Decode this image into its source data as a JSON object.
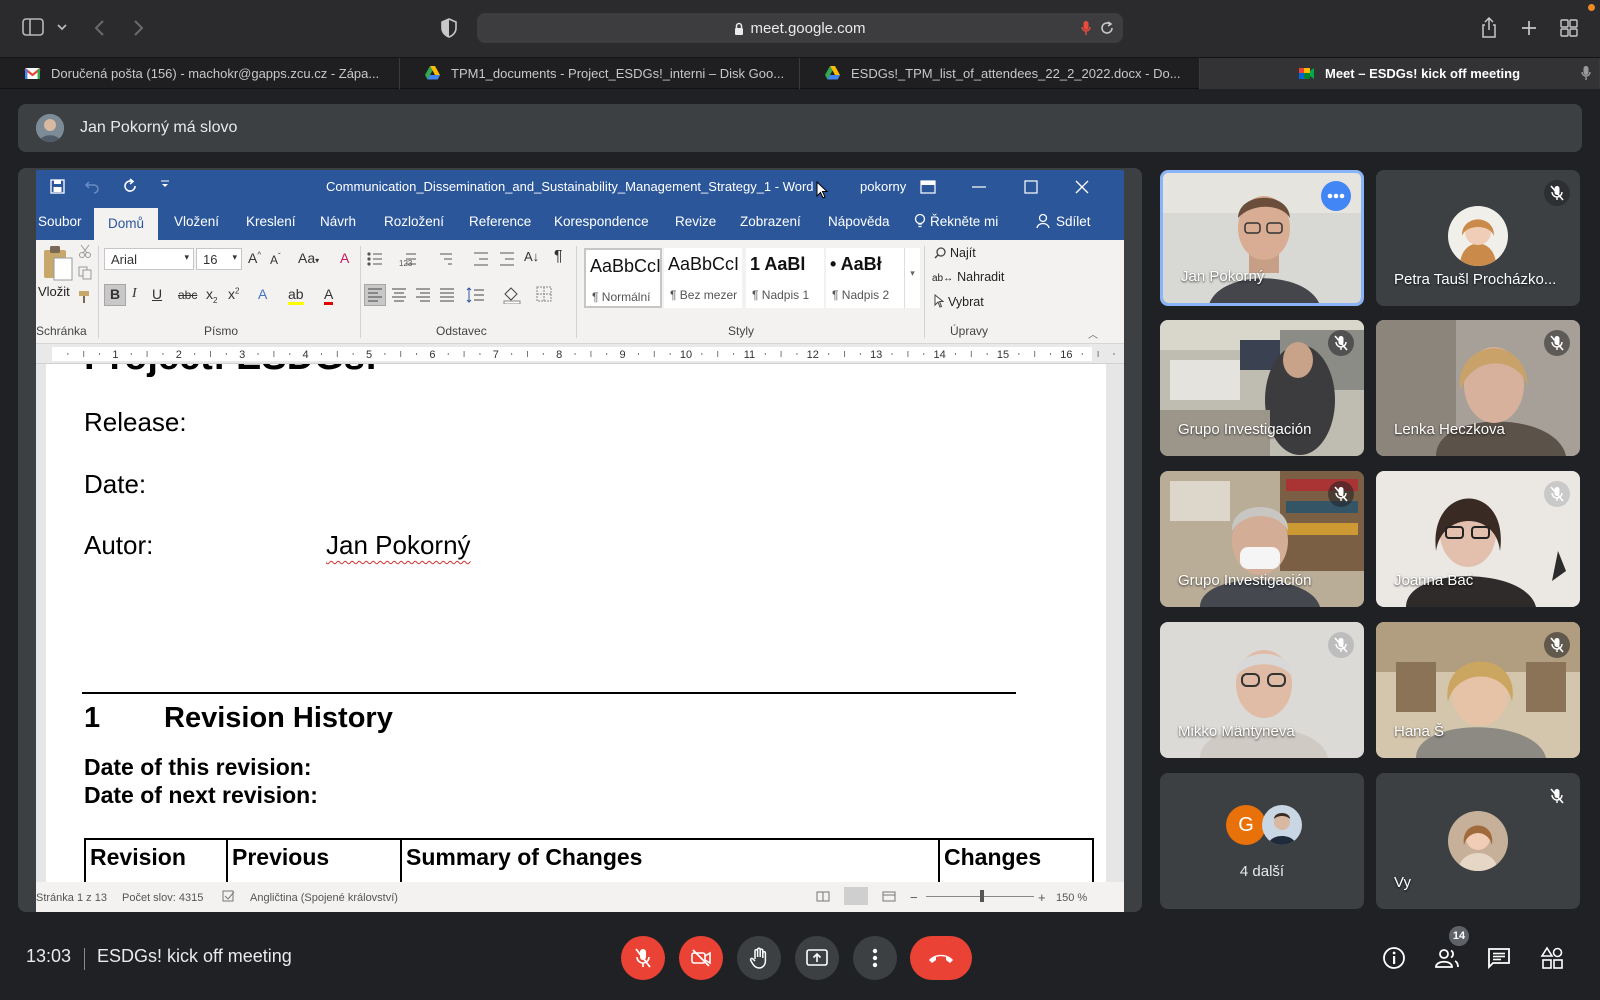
{
  "browser": {
    "url": "meet.google.com",
    "tabs": [
      {
        "label": "Doručená pošta (156) - machokr@gapps.zcu.cz - Zápa...",
        "icon": "gmail-icon"
      },
      {
        "label": "TPM1_documents - Project_ESDGs!_interni – Disk Goo...",
        "icon": "google-drive-icon"
      },
      {
        "label": "ESDGs!_TPM_list_of_attendees_22_2_2022.docx - Do...",
        "icon": "google-drive-icon"
      },
      {
        "label": "Meet – ESDGs! kick off meeting",
        "icon": "google-meet-icon",
        "active": true
      }
    ]
  },
  "meet": {
    "speaker_banner": "Jan Pokorný má slovo",
    "clock": "13:03",
    "meeting_title": "ESDGs! kick off meeting",
    "people_count": "14",
    "participants": [
      {
        "name": "Jan Pokorný",
        "speaking": true,
        "muted": false
      },
      {
        "name": "Petra Taušl Procházko...",
        "muted": true,
        "avatar": true
      },
      {
        "name": "Grupo Investigación",
        "muted": true
      },
      {
        "name": "Lenka Heczkova",
        "muted": true
      },
      {
        "name": "Grupo Investigación",
        "muted": true
      },
      {
        "name": "Joanna Bać",
        "muted": true
      },
      {
        "name": "Mikko Mäntyneva",
        "muted": true
      },
      {
        "name": "Hana Š",
        "muted": true
      },
      {
        "name": "4 další",
        "avatars": [
          "G"
        ]
      },
      {
        "name": "Vy",
        "muted": true,
        "avatar": true
      }
    ],
    "accent_colors": {
      "end_call": "#ea4335",
      "speaking": "#8ab4f8",
      "avatar_g": "#e8710a"
    }
  },
  "word": {
    "title": "Communication_Dissemination_and_Sustainability_Management_Strategy_1  -  Word",
    "user": "pokorny",
    "tabs": [
      "Soubor",
      "Domů",
      "Vložení",
      "Kreslení",
      "Návrh",
      "Rozložení",
      "Reference",
      "Korespondence",
      "Revize",
      "Zobrazení",
      "Nápověda"
    ],
    "tell_me": "Řekněte mi",
    "share": "Sdílet",
    "ribbon": {
      "paste": "Vložit",
      "font_name": "Arial",
      "font_size": "16",
      "group_clipboard": "Schránka",
      "group_font": "Písmo",
      "group_paragraph": "Odstavec",
      "group_styles": "Styly",
      "group_editing": "Úpravy",
      "styles": [
        {
          "preview": "AaBbCcI",
          "name": "¶ Normální"
        },
        {
          "preview": "AaBbCcI",
          "name": "¶ Bez mezer"
        },
        {
          "preview": "1  AaBl",
          "name": "¶ Nadpis 1"
        },
        {
          "preview": "•  AaBł",
          "name": "¶ Nadpis 2"
        }
      ],
      "find": "Najít",
      "replace": "Nahradit",
      "select": "Vybrat"
    },
    "ruler_numbers": [
      "1",
      "2",
      "3",
      "4",
      "5",
      "6",
      "7",
      "8",
      "9",
      "10",
      "11",
      "12",
      "13",
      "14",
      "15",
      "16"
    ],
    "document": {
      "project_fragment": "Project: ESDGs!",
      "release_label": "Release:",
      "date_label": "Date:",
      "author_label": "Autor:",
      "author_value": "Jan Pokorný",
      "section_number": "1",
      "section_title": "Revision History",
      "this_revision": "Date of this revision:",
      "next_revision": "Date of next revision:",
      "table_headers": [
        "Revision",
        "Previous",
        "Summary of Changes",
        "Changes"
      ]
    },
    "status": {
      "page": "Stránka 1 z 13",
      "words": "Počet slov: 4315",
      "language": "Angličtina (Spojené království)",
      "zoom": "150 %"
    }
  }
}
